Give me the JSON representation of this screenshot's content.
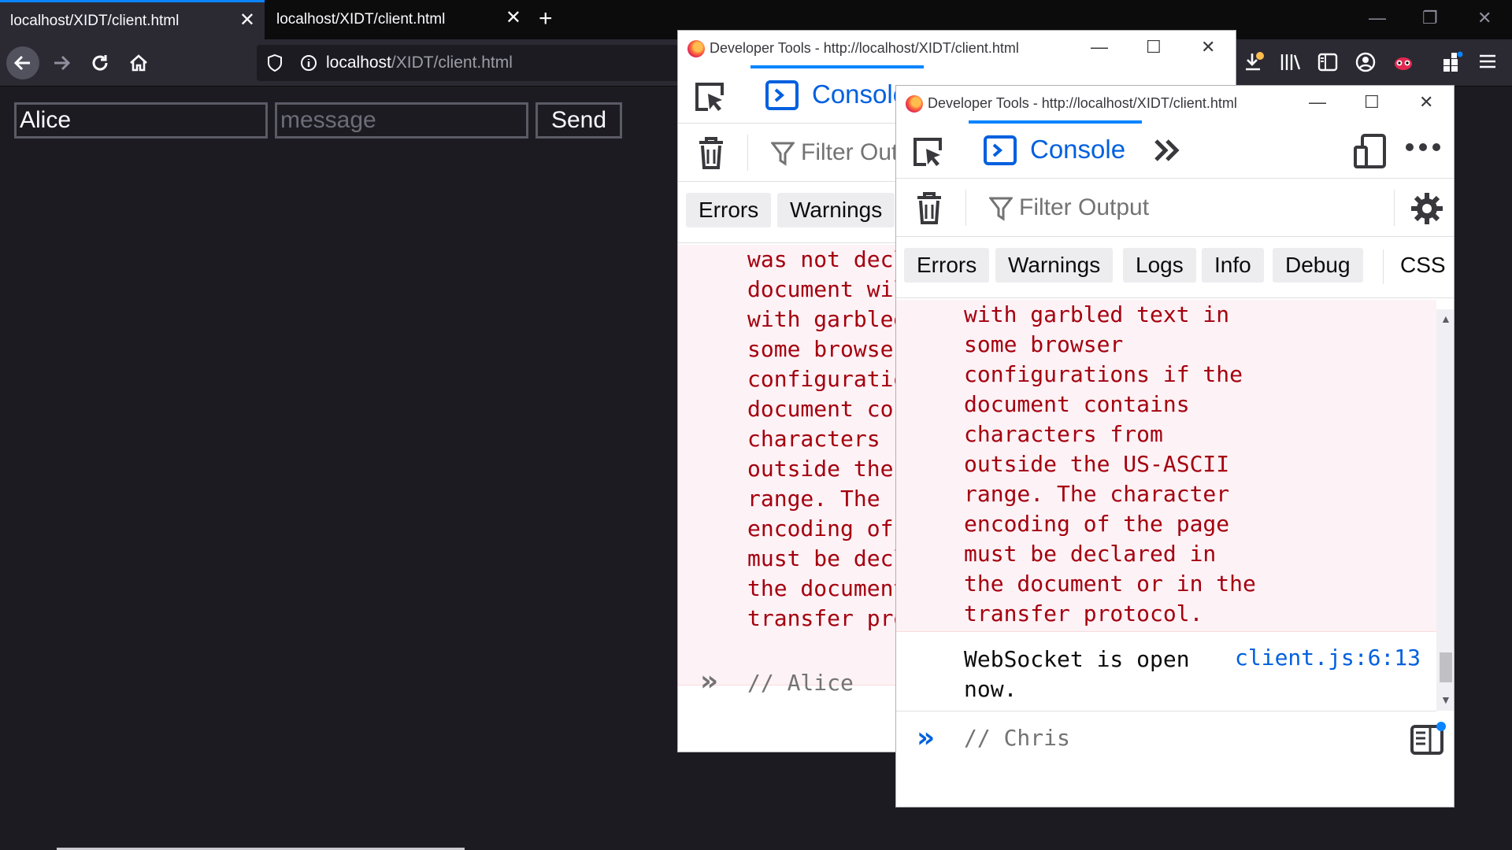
{
  "browser": {
    "tabs": [
      {
        "label": "localhost/XIDT/client.html",
        "active": true
      },
      {
        "label": "localhost/XIDT/client.html",
        "active": false
      }
    ],
    "url_host": "localhost",
    "url_path": "/XIDT/client.html"
  },
  "page": {
    "name_value": "Alice",
    "message_placeholder": "message",
    "send_label": "Send"
  },
  "devtools_back": {
    "title": "Developer Tools - http://localhost/XIDT/client.html",
    "console_label": "Console",
    "filter_placeholder": "Filter Out",
    "filters": [
      "Errors",
      "Warnings"
    ],
    "error_text": "was not decl\ndocument wil\nwith garbled\nsome browser\nconfiguratio\ndocument con\ncharacters f\noutside the\nrange. The c\nencoding of\nmust be decl\nthe document\ntransfer pro",
    "input_text": "// Alice"
  },
  "devtools_front": {
    "title": "Developer Tools - http://localhost/XIDT/client.html",
    "console_label": "Console",
    "filter_placeholder": "Filter Output",
    "filters": [
      "Errors",
      "Warnings",
      "Logs",
      "Info",
      "Debug"
    ],
    "css_label": "CSS",
    "error_text": "with garbled text in\nsome browser\nconfigurations if the\ndocument contains\ncharacters from\noutside the US-ASCII\nrange. The character\nencoding of the page\nmust be declared in\nthe document or in the\ntransfer protocol.",
    "log_text": "WebSocket is open\nnow.",
    "log_source": "client.js:6:13",
    "input_text": "// Chris"
  },
  "icons": {
    "back": "arrow-left-icon",
    "forward": "arrow-right-icon",
    "reload": "reload-icon",
    "home": "home-icon",
    "shield": "shield-icon",
    "info": "info-icon",
    "picker": "element-picker-icon",
    "trash": "trash-icon",
    "filter": "filter-icon",
    "gear": "gear-icon",
    "more": "more-icon",
    "responsive": "responsive-design-icon",
    "sidebar": "sidebar-toggle-icon"
  },
  "colors": {
    "accent": "#0a84ff",
    "error_text": "#a4000f",
    "error_bg": "#fdf2f5",
    "link": "#0060df"
  }
}
